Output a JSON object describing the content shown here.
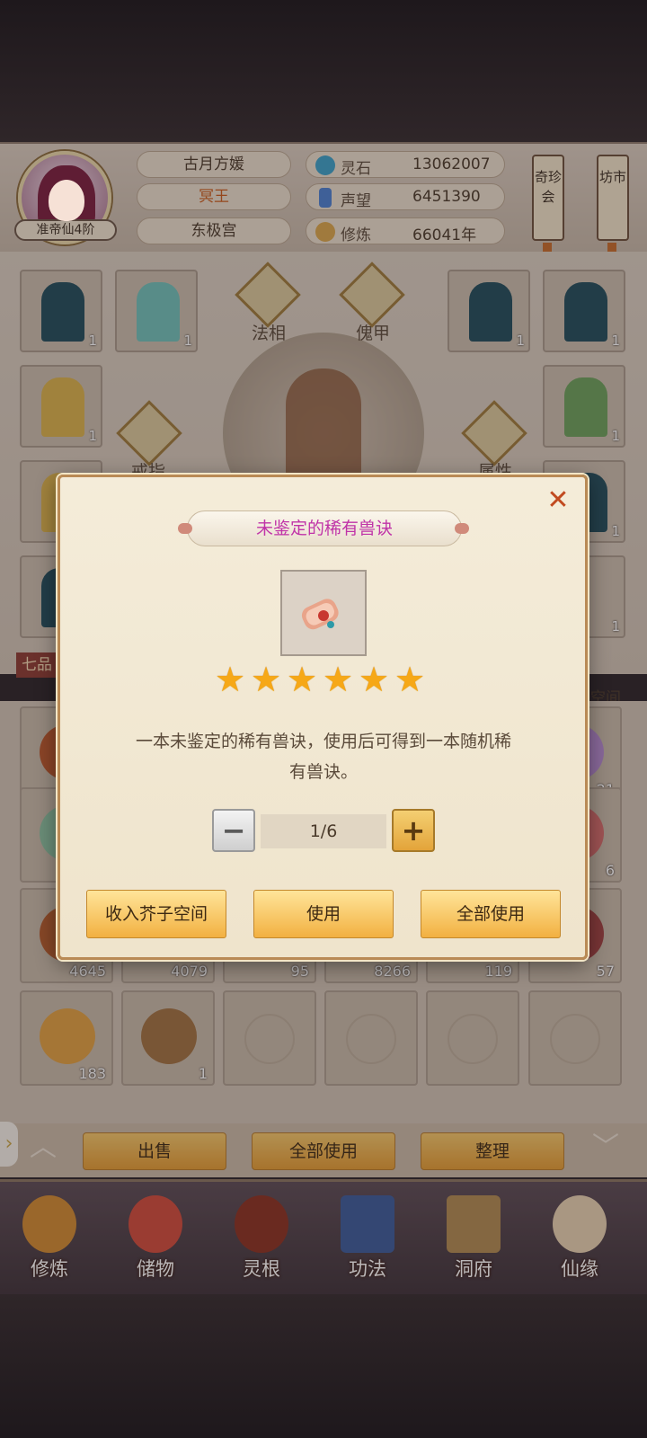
{
  "header": {
    "rank": "准帝仙4阶",
    "name": "古月方媛",
    "title": "冥王",
    "sect": "东极宫",
    "resources": [
      {
        "label": "灵石",
        "value": "13062007",
        "icon": "spirit-stone-icon",
        "color": "#3aa0c8"
      },
      {
        "label": "声望",
        "value": "6451390",
        "icon": "crystal-icon",
        "color": "#4a7fd0"
      },
      {
        "label": "修炼",
        "value": "66041年",
        "icon": "meditation-icon",
        "color": "#d9a54a"
      }
    ],
    "banners": [
      "奇珍会",
      "坊市"
    ]
  },
  "equipment": {
    "labels": [
      "法相",
      "傀甲",
      "戒指",
      "属性"
    ],
    "counts": [
      "1",
      "1",
      "1",
      "1",
      "1",
      "1",
      "1",
      "1",
      "1"
    ]
  },
  "grade_label": "七品",
  "space_label": "子空间",
  "inventory": {
    "counts_row1": [
      "21"
    ],
    "counts_row2": [
      "6"
    ],
    "counts_row3": [
      "4645",
      "4079",
      "95",
      "8266",
      "119",
      "57"
    ],
    "counts_row4": [
      "183",
      "1"
    ]
  },
  "action_bar": {
    "sell": "出售",
    "use_all": "全部使用",
    "sort": "整理"
  },
  "nav": [
    "修炼",
    "储物",
    "灵根",
    "功法",
    "洞府",
    "仙缘"
  ],
  "modal": {
    "title": "未鉴定的稀有兽诀",
    "stars": 6,
    "description_line1": "一本未鉴定的稀有兽诀，使用后可得到一本随机稀",
    "description_line2": "有兽诀。",
    "quantity": "1/6",
    "buttons": {
      "store": "收入芥子空间",
      "use": "使用",
      "use_all": "全部使用"
    },
    "close": "✕"
  }
}
